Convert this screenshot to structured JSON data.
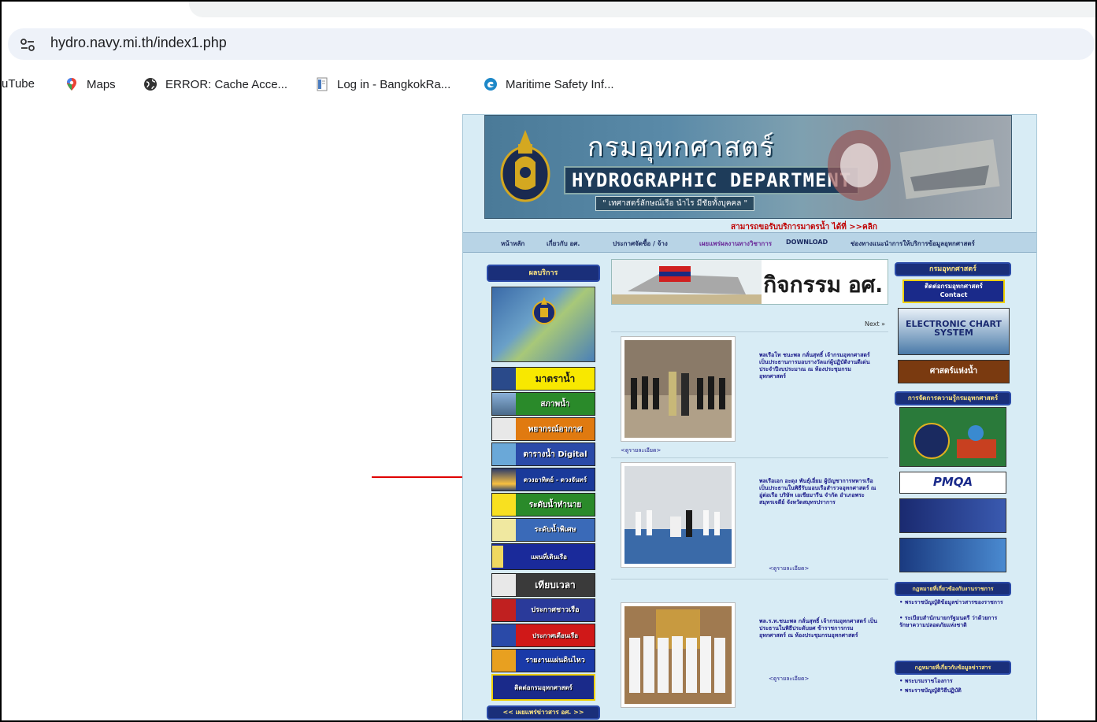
{
  "browser": {
    "url": "hydro.navy.mi.th/index1.php",
    "bookmarks": [
      {
        "label": "uTube",
        "icon": "youtube-icon"
      },
      {
        "label": "Maps",
        "icon": "maps-pin-icon"
      },
      {
        "label": "ERROR: Cache Acce...",
        "icon": "globe-icon"
      },
      {
        "label": "Log in - BangkokRa...",
        "icon": "page-icon"
      },
      {
        "label": "Maritime Safety Inf...",
        "icon": "edge-icon"
      }
    ]
  },
  "site": {
    "banner_th": "กรมอุทกศาสตร์",
    "banner_en": "HYDROGRAPHIC DEPARTMENT",
    "banner_motto": "\" เทศาสตร์ลักษณ์เรือ นำไร มีชัยทั้งบุคคล \"",
    "marquee": "สามารถขอรับบริการมาตรน้ำ ได้ที่ >>คลิก",
    "nav": [
      "หน้าหลัก",
      "เกี่ยวกับ อศ.",
      "ประกาศจัดซื้อ / จ้าง",
      "เผยแพร่ผลงานทางวิชาการ",
      "DOWNLOAD",
      "ช่องทางแนะนำการให้บริการข้อมูลอุทกศาสตร์"
    ],
    "left": {
      "caption": "ผลบริการ",
      "items": [
        "มาตราน้ำ",
        "สภาพน้ำ",
        "พยากรณ์อากาศ",
        "ตารางน้ำ Digital",
        "ดวงอาทิตย์ - ดวงจันทร์",
        "ระดับน้ำทำนาย",
        "ระดับน้ำพิเศษ",
        "แผนที่เดินเรือ",
        "เทียบเวลา",
        "ประกาศชาวเรือ",
        "ประกาศเตือนเรือ",
        "รายงานแผ่นดินไหว",
        "ติดต่อกรมอุทกศาสตร์"
      ],
      "bottom": "<< เผยแพร่ข่าวสาร อศ. >>"
    },
    "center": {
      "title": "กิจกรรม อศ.",
      "next": "Next »",
      "more": "<ดูรายละเอียด>",
      "news": [
        "พลเรือโท ชนะพล กลั่นสุทธิ์ เจ้ากรมอุทกศาสตร์ เป็นประธานการมอบรางวัลแก่ผู้ปฏิบัติงานดีเด่นประจำปีงบประมาณ ณ ห้องประชุมกรมอุทกศาสตร์",
        "พลเรือเอก อะดุง พันธุ์เอี่ยม ผู้บัญชาการทหารเรือ เป็นประธานในพิธีรับมอบเรือสำรวจอุทกศาสตร์ ณ อู่ต่อเรือ บริษัท เอเชียมารีน จำกัด อำเภอพระสมุทรเจดีย์ จังหวัดสมุทรปราการ",
        "พล.ร.ท.ชนะพล กลั่นสุทธิ์ เจ้ากรมอุทกศาสตร์ เป็นประธานในพิธีประดับยศ ข้าราชการกรมอุทกศาสตร์ ณ ห้องประชุมกรมอุทกศาสตร์"
      ]
    },
    "right": {
      "caption": "กรมอุทกศาสตร์",
      "contact": "ติดต่อกรมอุทกศาสตร์",
      "contact_en": "Contact",
      "ecs": "ELECTRONIC CHART SYSTEM",
      "oceanography": "ศาสตร์แห่งน้ำ",
      "knowledge": "การจัดการความรู้กรมอุทกศาสตร์",
      "pmqa": "PMQA",
      "laws_title": "กฎหมายที่เกี่ยวข้องกับงานราชการ",
      "laws": [
        "• พระราชบัญญัติข้อมูลข่าวสารของราชการ",
        "• ระเบียบสำนักนายกรัฐมนตรี ว่าด้วยการรักษาความปลอดภัยแห่งชาติ"
      ],
      "info_title": "กฎหมายที่เกี่ยวกับข้อมูลข่าวสาร",
      "info": [
        "• พระบรมราชโองการ",
        "• พระราชบัญญัติวิธีปฏิบัติ"
      ]
    }
  },
  "colors": {
    "annotation_arrow": "#e00000",
    "nav_bg": "#b8d4e6",
    "page_bg": "#d8ecf5"
  }
}
